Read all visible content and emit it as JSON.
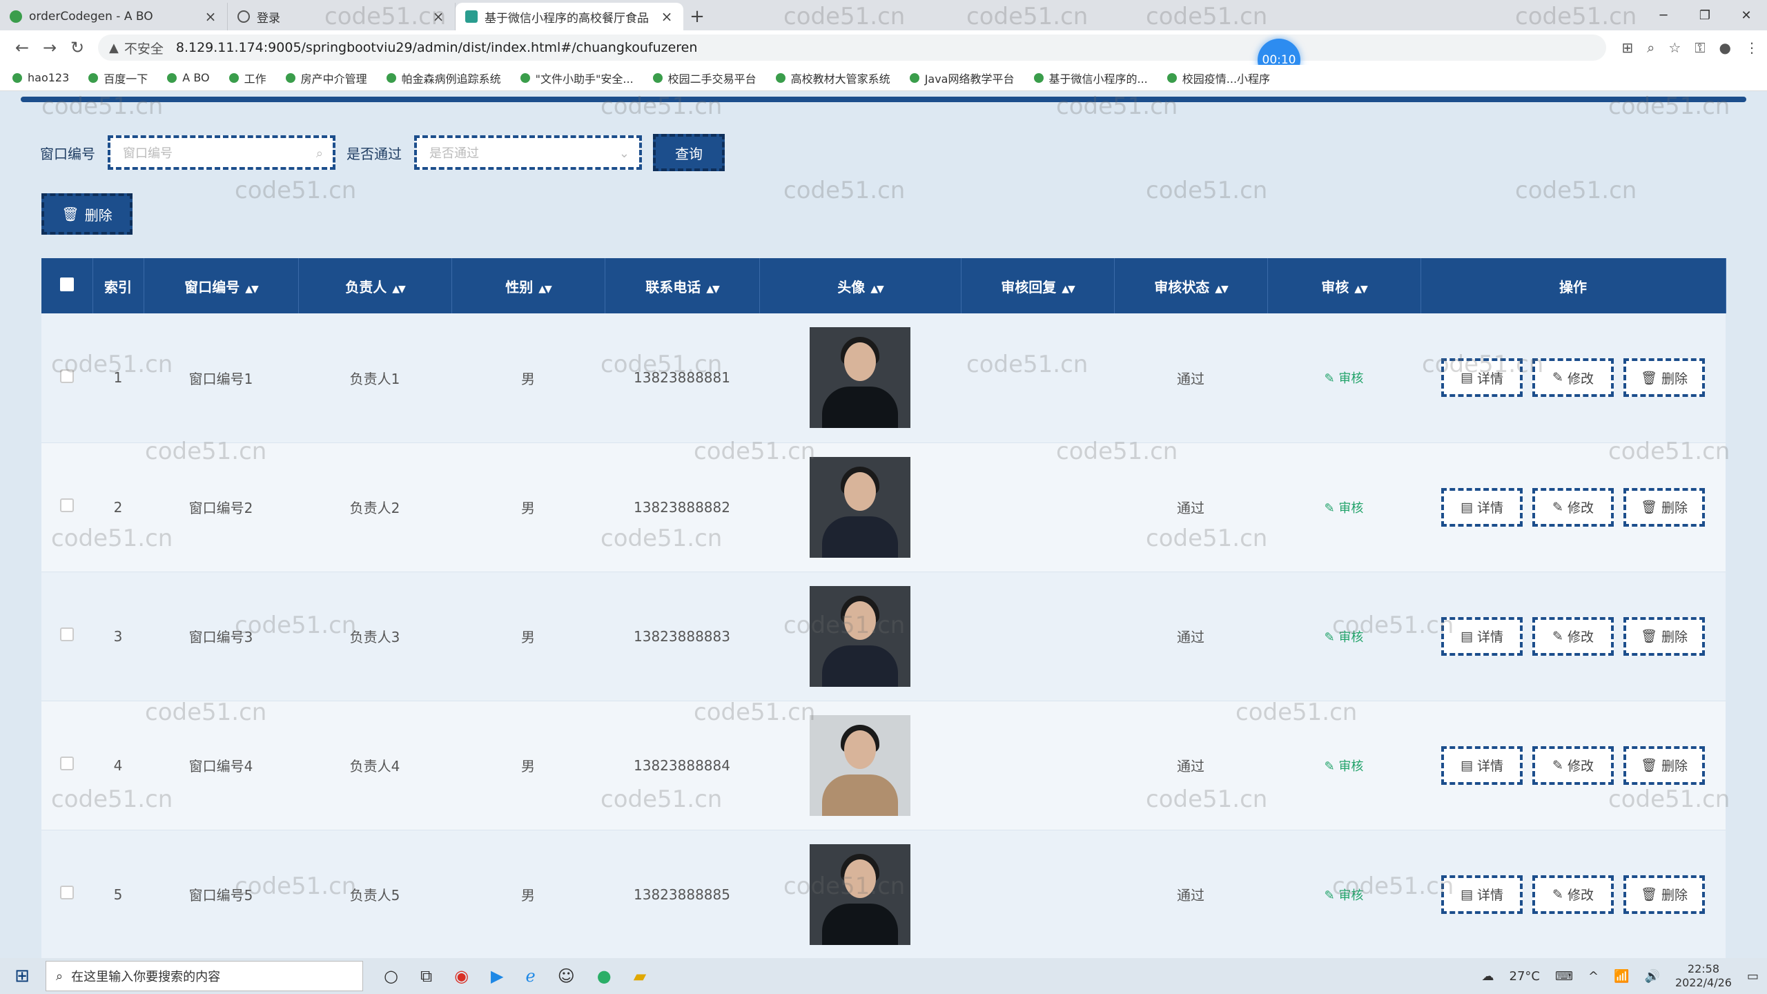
{
  "browser": {
    "tabs": [
      {
        "title": "orderCodegen - A BO",
        "active": false
      },
      {
        "title": "登录",
        "active": false
      },
      {
        "title": "基于微信小程序的高校餐厅食品",
        "active": true
      }
    ],
    "url": "8.129.11.174:9005/springbootviu29/admin/dist/index.html#/chuangkoufuzeren",
    "insecure_label": "不安全",
    "timer": "00:10",
    "bookmarks": [
      "hao123",
      "百度一下",
      "A BO",
      "工作",
      "房产中介管理",
      "帕金森病例追踪系统",
      "\"文件小助手\"安全...",
      "校园二手交易平台",
      "高校教材大管家系统",
      "Java网络教学平台",
      "基于微信小程序的...",
      "校园疫情...小程序"
    ]
  },
  "search": {
    "window_label": "窗口编号",
    "window_placeholder": "窗口编号",
    "pass_label": "是否通过",
    "pass_placeholder": "是否通过",
    "query_button": "查询",
    "delete_button": "删除"
  },
  "table": {
    "headers": [
      "索引",
      "窗口编号",
      "负责人",
      "性别",
      "联系电话",
      "头像",
      "审核回复",
      "审核状态",
      "审核",
      "操作"
    ],
    "rows": [
      {
        "index": "1",
        "window": "窗口编号1",
        "person": "负责人1",
        "gender": "男",
        "phone": "13823888881",
        "reply": "",
        "status": "通过",
        "audit": "审核"
      },
      {
        "index": "2",
        "window": "窗口编号2",
        "person": "负责人2",
        "gender": "男",
        "phone": "13823888882",
        "reply": "",
        "status": "通过",
        "audit": "审核"
      },
      {
        "index": "3",
        "window": "窗口编号3",
        "person": "负责人3",
        "gender": "男",
        "phone": "13823888883",
        "reply": "",
        "status": "通过",
        "audit": "审核"
      },
      {
        "index": "4",
        "window": "窗口编号4",
        "person": "负责人4",
        "gender": "男",
        "phone": "13823888884",
        "reply": "",
        "status": "通过",
        "audit": "审核"
      },
      {
        "index": "5",
        "window": "窗口编号5",
        "person": "负责人5",
        "gender": "男",
        "phone": "13823888885",
        "reply": "",
        "status": "通过",
        "audit": "审核"
      }
    ],
    "ops": {
      "detail": "详情",
      "edit": "修改",
      "delete": "删除"
    }
  },
  "watermark_text": "code51.cn",
  "taskbar": {
    "search_placeholder": "在这里输入你要搜索的内容",
    "weather": "27°C",
    "time": "22:58",
    "date": "2022/4/26"
  },
  "colors": {
    "primary": "#1c4e8c",
    "audit_green": "#22a36a"
  }
}
